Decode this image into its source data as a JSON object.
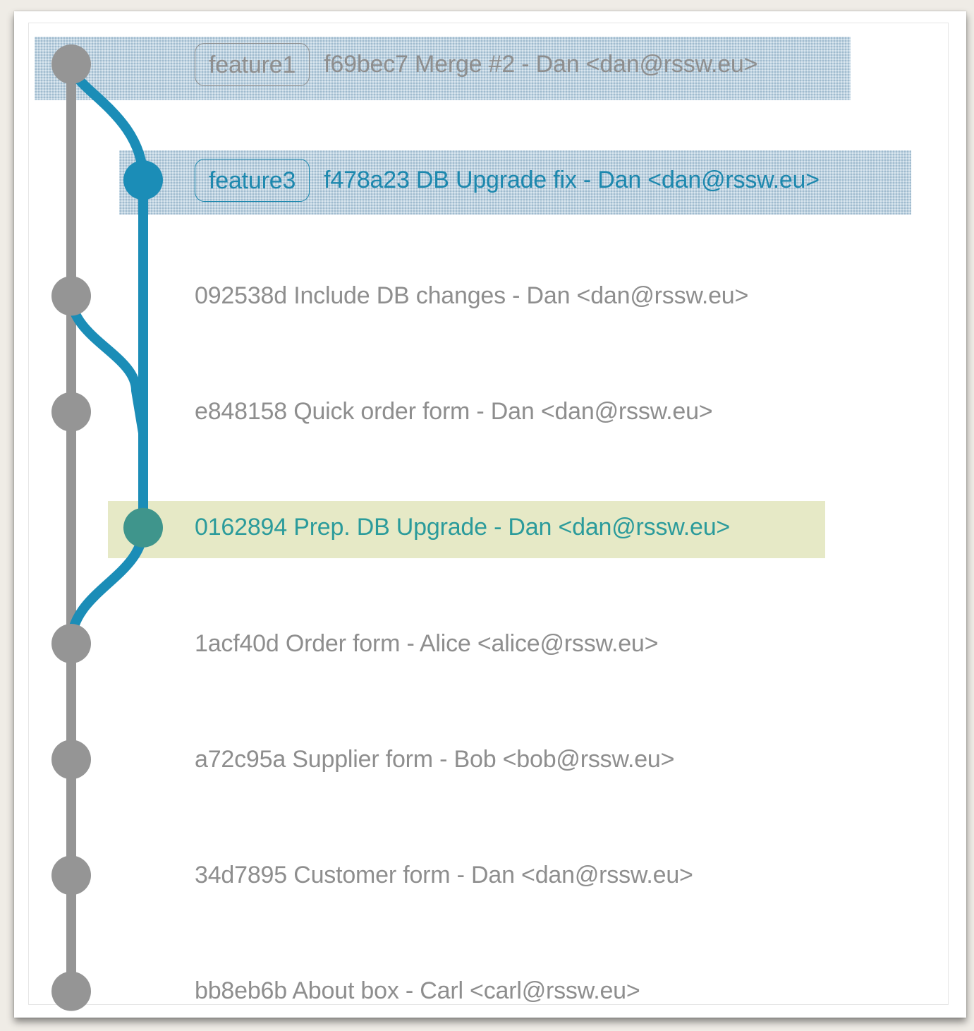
{
  "graph": {
    "colors": {
      "main": "#959595",
      "branch": "#1b8db7",
      "highlight_node": "#3f958c"
    },
    "commits": [
      {
        "ref": "feature1",
        "hash": "f69bec7",
        "message": "Merge #2",
        "author": "Dan <dan@rssw.eu>",
        "lane": 0,
        "color": "main",
        "text_color": "gray",
        "band": "selected"
      },
      {
        "ref": "feature3",
        "hash": "f478a23",
        "message": "DB Upgrade fix",
        "author": "Dan <dan@rssw.eu>",
        "lane": 1,
        "color": "branch",
        "text_color": "blue",
        "band": "selected"
      },
      {
        "hash": "092538d",
        "message": "Include DB changes",
        "author": "Dan <dan@rssw.eu>",
        "lane": 0,
        "color": "main",
        "text_color": "gray"
      },
      {
        "hash": "e848158",
        "message": "Quick order form",
        "author": "Dan <dan@rssw.eu>",
        "lane": 0,
        "color": "main",
        "text_color": "gray"
      },
      {
        "hash": "0162894",
        "message": "Prep. DB Upgrade",
        "author": "Dan <dan@rssw.eu>",
        "lane": 1,
        "color": "highlight_node",
        "text_color": "teal",
        "band": "current"
      },
      {
        "hash": "1acf40d",
        "message": "Order form",
        "author": "Alice <alice@rssw.eu>",
        "lane": 0,
        "color": "main",
        "text_color": "gray"
      },
      {
        "hash": "a72c95a",
        "message": "Supplier form",
        "author": "Bob <bob@rssw.eu>",
        "lane": 0,
        "color": "main",
        "text_color": "gray"
      },
      {
        "hash": "34d7895",
        "message": "Customer form",
        "author": "Dan <dan@rssw.eu>",
        "lane": 0,
        "color": "main",
        "text_color": "gray"
      },
      {
        "hash": "bb8eb6b",
        "message": "About box",
        "author": "Carl <carl@rssw.eu>",
        "lane": 0,
        "color": "main",
        "text_color": "gray"
      }
    ],
    "edges": [
      {
        "from": 0,
        "to": 1,
        "color": "branch"
      },
      {
        "from": 1,
        "to": 4,
        "color": "branch"
      },
      {
        "from": 2,
        "to": 4,
        "color": "branch"
      },
      {
        "from": 4,
        "to": 5,
        "color": "branch"
      },
      {
        "from": 0,
        "to": 8,
        "color": "main"
      }
    ]
  },
  "rows": [
    {
      "ref": "feature1",
      "text": "f69bec7 Merge #2 - Dan <dan@rssw.eu>"
    },
    {
      "ref": "feature3",
      "text": "f478a23 DB Upgrade fix - Dan <dan@rssw.eu>"
    },
    {
      "text": "092538d Include DB changes - Dan <dan@rssw.eu>"
    },
    {
      "text": "e848158 Quick order form - Dan <dan@rssw.eu>"
    },
    {
      "text": "0162894 Prep. DB Upgrade - Dan <dan@rssw.eu>"
    },
    {
      "text": "1acf40d Order form - Alice <alice@rssw.eu>"
    },
    {
      "text": "a72c95a Supplier form - Bob <bob@rssw.eu>"
    },
    {
      "text": "34d7895 Customer form - Dan <dan@rssw.eu>"
    },
    {
      "text": "bb8eb6b About box - Carl <carl@rssw.eu>"
    }
  ]
}
